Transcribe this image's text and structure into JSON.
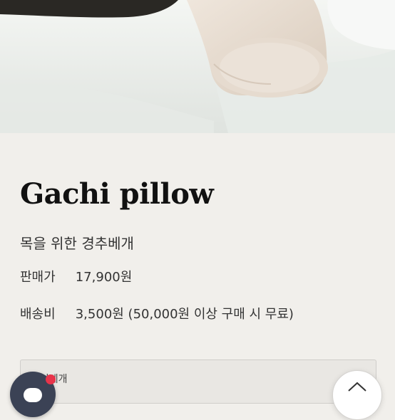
{
  "hero": {
    "image_name": "pillow-product-photo"
  },
  "product": {
    "title": "Gachi pillow",
    "subtitle": "목을 위한 경추베개",
    "price_label": "판매가",
    "price_value": "17,900원",
    "shipping_label": "배송비",
    "shipping_value": "3,500원 (50,000원 이상 구매 시 무료)"
  },
  "option": {
    "text": "같이베개"
  },
  "colors": {
    "background": "#f1efeb",
    "chat_button": "#3b4255",
    "notification_dot": "#e8344a"
  },
  "icons": {
    "chat": "chat-bubble-icon",
    "scroll_top": "chevron-up-icon"
  }
}
